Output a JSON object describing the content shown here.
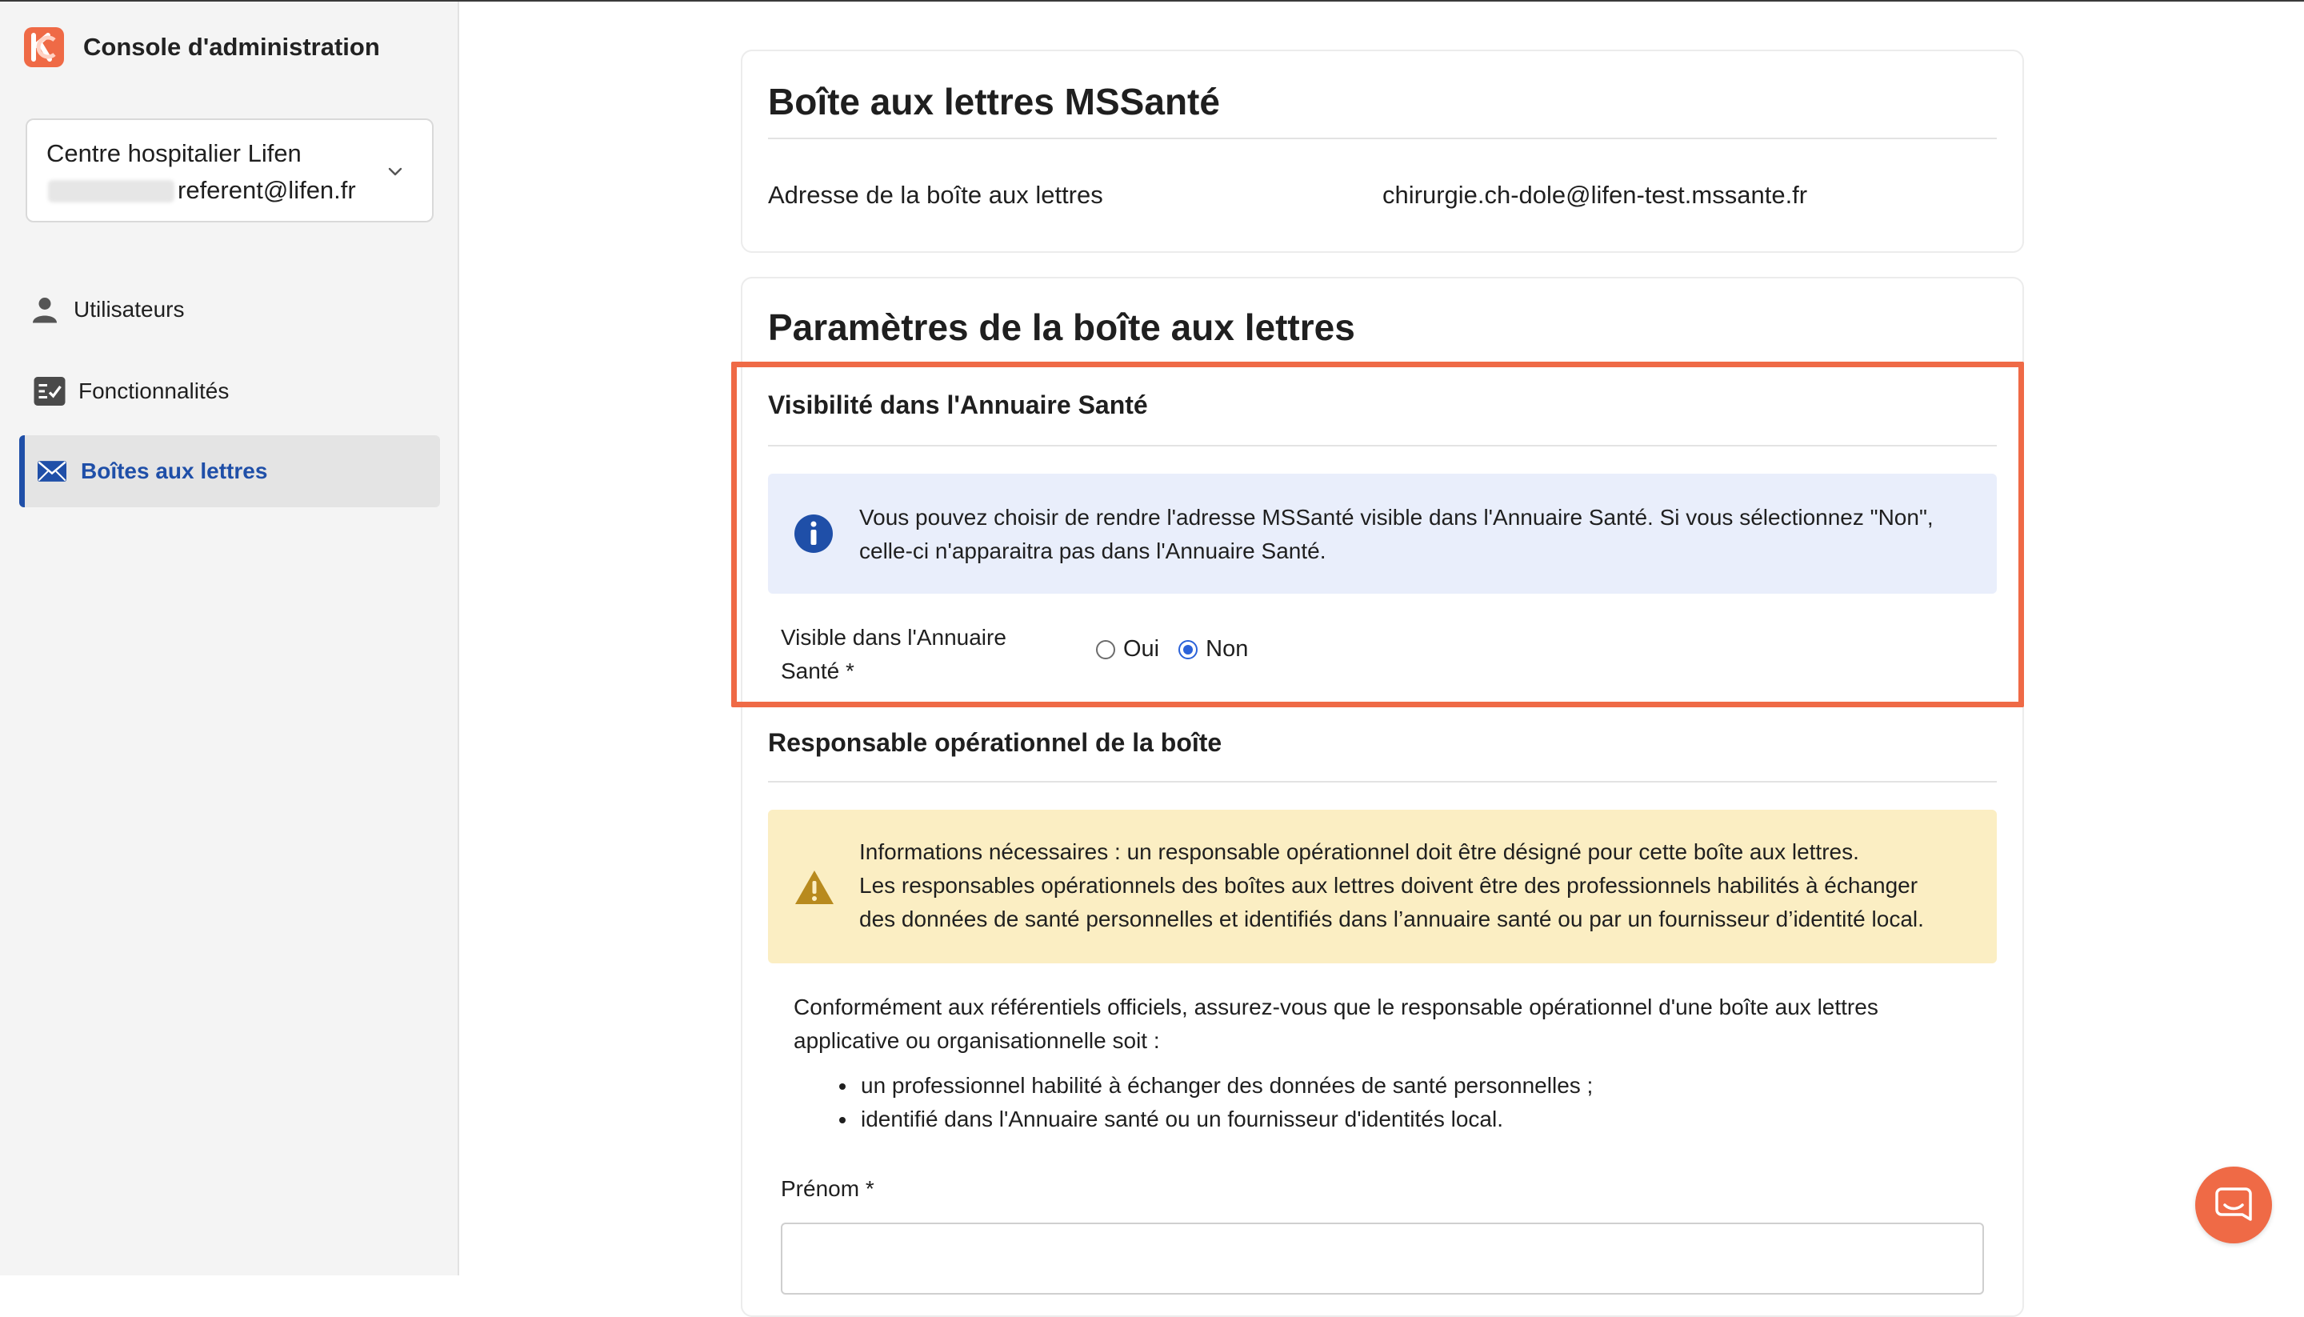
{
  "app": {
    "title": "Console d'administration"
  },
  "org_selector": {
    "organization": "Centre hospitalier Lifen",
    "email": "referent@lifen.fr"
  },
  "nav": {
    "items": [
      {
        "label": "Utilisateurs",
        "icon": "user-icon"
      },
      {
        "label": "Fonctionnalités",
        "icon": "checklist-icon"
      },
      {
        "label": "Boîtes aux lettres",
        "icon": "mail-icon",
        "active": true
      }
    ]
  },
  "mailbox_card": {
    "title": "Boîte aux lettres MSSanté",
    "address_label": "Adresse de la boîte aux lettres",
    "address_value": "chirurgie.ch-dole@lifen-test.mssante.fr"
  },
  "params_card": {
    "title": "Paramètres de la boîte aux lettres",
    "visibility": {
      "section_title": "Visibilité dans l'Annuaire Santé",
      "info_line1": "Vous pouvez choisir de rendre l'adresse MSSanté visible dans l'Annuaire Santé. Si vous sélectionnez \"Non\",",
      "info_line2": "celle-ci n'apparaitra pas dans l'Annuaire Santé.",
      "field_label_line1": "Visible dans l'Annuaire",
      "field_label_line2": "Santé *",
      "options": [
        "Oui",
        "Non"
      ],
      "selected": "Non"
    },
    "responsible": {
      "section_title": "Responsable opérationnel de la boîte",
      "warn_line1": "Informations nécessaires : un responsable opérationnel doit être désigné pour cette boîte aux lettres.",
      "warn_line2": "Les responsables opérationnels des boîtes aux lettres doivent être des professionnels habilités à échanger",
      "warn_line3": "des données de santé personnelles et identifiés dans l’annuaire santé ou par un fournisseur d’identité local.",
      "body_line1": "Conformément aux référentiels officiels, assurez-vous que le responsable opérationnel d'une boîte aux lettres",
      "body_line2": "applicative ou organisationnelle soit :",
      "bullets": [
        "un professionnel habilité à échanger des données de santé personnelles ;",
        "identifié dans l'Annuaire santé ou un fournisseur d'identités local."
      ],
      "firstname_label": "Prénom *",
      "firstname_value": ""
    }
  },
  "colors": {
    "accent": "#1f4fa8",
    "highlight": "#ef6a46",
    "info_bg": "#e9eefb",
    "warn_bg": "#fbeec3",
    "info_icon": "#1f4fa8",
    "warn_icon": "#b88a1e"
  }
}
